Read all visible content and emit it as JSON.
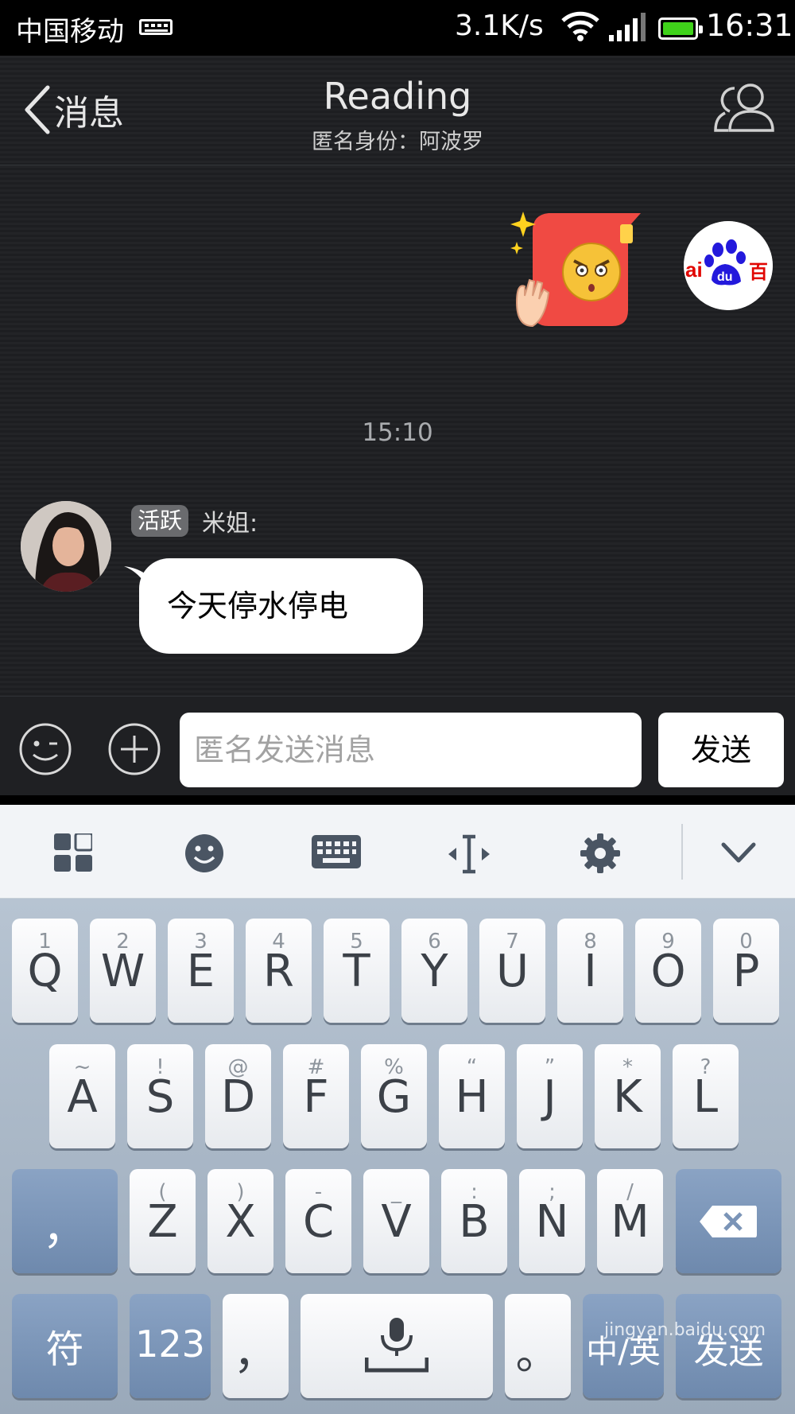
{
  "status_bar": {
    "carrier": "中国移动",
    "speed": "3.1K/s",
    "time": "16:31",
    "icons": [
      "keyboard-notify-icon",
      "wifi-icon",
      "signal-icon",
      "battery-icon"
    ],
    "battery_level": 0.9
  },
  "nav": {
    "back_label": "消息",
    "title": "Reading",
    "subtitle": "匿名身份：阿波罗",
    "right_icon": "group-members-icon"
  },
  "messages": {
    "timestamp": "15:10",
    "sticker_icon": "angry-face-sticker-icon",
    "sender_badge": "活跃",
    "sender_name": "米姐:",
    "text": "今天停水停电"
  },
  "input": {
    "emoji_icon": "emoji-icon",
    "plus_icon": "plus-icon",
    "placeholder": "匿名发送消息",
    "send_label": "发送"
  },
  "keyboard": {
    "toolbar_icons": [
      "grid-icon",
      "smiley-icon",
      "keyboard-icon",
      "cursor-icon",
      "gear-icon",
      "chevron-down-icon"
    ],
    "row1": [
      {
        "hint": "1",
        "key": "Q"
      },
      {
        "hint": "2",
        "key": "W"
      },
      {
        "hint": "3",
        "key": "E"
      },
      {
        "hint": "4",
        "key": "R"
      },
      {
        "hint": "5",
        "key": "T"
      },
      {
        "hint": "6",
        "key": "Y"
      },
      {
        "hint": "7",
        "key": "U"
      },
      {
        "hint": "8",
        "key": "I"
      },
      {
        "hint": "9",
        "key": "O"
      },
      {
        "hint": "0",
        "key": "P"
      }
    ],
    "row2": [
      {
        "hint": "~",
        "key": "A"
      },
      {
        "hint": "!",
        "key": "S"
      },
      {
        "hint": "@",
        "key": "D"
      },
      {
        "hint": "#",
        "key": "F"
      },
      {
        "hint": "%",
        "key": "G"
      },
      {
        "hint": "“",
        "key": "H"
      },
      {
        "hint": "”",
        "key": "J"
      },
      {
        "hint": "*",
        "key": "K"
      },
      {
        "hint": "?",
        "key": "L"
      }
    ],
    "row3_left": "，",
    "row3": [
      {
        "hint": "(",
        "key": "Z"
      },
      {
        "hint": ")",
        "key": "X"
      },
      {
        "hint": "-",
        "key": "C"
      },
      {
        "hint": "_",
        "key": "V"
      },
      {
        "hint": ":",
        "key": "B"
      },
      {
        "hint": ";",
        "key": "N"
      },
      {
        "hint": "/",
        "key": "M"
      }
    ],
    "row4": {
      "symbols": "符",
      "numbers": "123",
      "comma": "，",
      "period": "。",
      "lang": "中/英",
      "send": "发送"
    },
    "watermark": "jingyan.baidu.com"
  },
  "colors": {
    "battery": "#3fd21a",
    "sticker_red": "#f04a43",
    "dark_key": "#7b94b7",
    "baidu_blue": "#2319dc",
    "baidu_red": "#e10602"
  }
}
